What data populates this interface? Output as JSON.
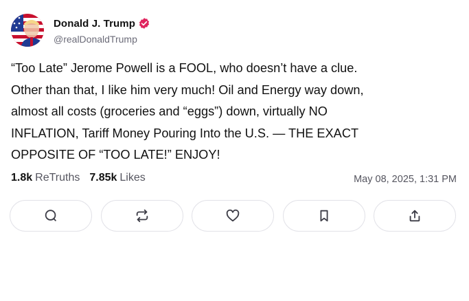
{
  "author": {
    "display_name": "Donald J. Trump",
    "handle": "@realDonaldTrump",
    "verified": true
  },
  "post": {
    "text": "“Too Late” Jerome Powell is a FOOL, who doesn’t have a clue.\nOther than that, I like him very much! Oil and Energy way down,\nalmost all costs (groceries and “eggs”) down, virtually NO\nINFLATION, Tariff Money Pouring Into the U.S. — THE EXACT\nOPPOSITE OF “TOO LATE!” ENJOY!",
    "timestamp": "May 08, 2025, 1:31 PM"
  },
  "stats": {
    "retruths_count": "1.8k",
    "retruths_label": "ReTruths",
    "likes_count": "7.85k",
    "likes_label": "Likes"
  },
  "actions": [
    {
      "icon": "reply-icon"
    },
    {
      "icon": "retruth-icon"
    },
    {
      "icon": "heart-icon"
    },
    {
      "icon": "bookmark-icon"
    },
    {
      "icon": "share-icon"
    }
  ],
  "colors": {
    "verified_badge": "#e0245e",
    "muted_text": "#6b6b78",
    "button_border": "#e2e2e8"
  }
}
